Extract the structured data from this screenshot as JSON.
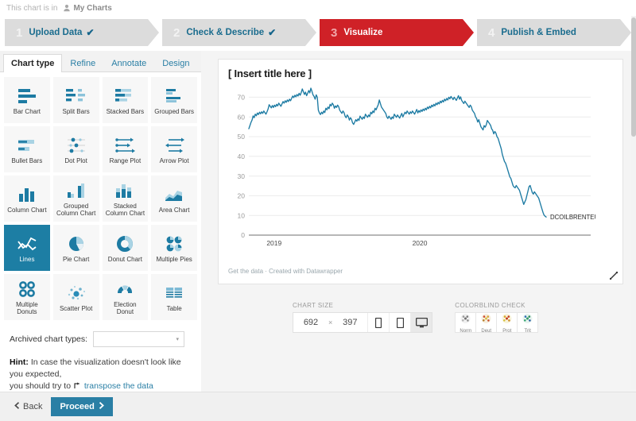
{
  "breadcrumb": {
    "prefix": "This chart is in",
    "location": "My Charts",
    "icon": "person-icon"
  },
  "steps": [
    {
      "num": "1",
      "label": "Upload Data",
      "check": "✔",
      "active": false
    },
    {
      "num": "2",
      "label": "Check & Describe",
      "check": "✔",
      "active": false
    },
    {
      "num": "3",
      "label": "Visualize",
      "check": "",
      "active": true
    },
    {
      "num": "4",
      "label": "Publish & Embed",
      "check": "",
      "active": false
    }
  ],
  "tabs": [
    {
      "label": "Chart type",
      "selected": true
    },
    {
      "label": "Refine",
      "selected": false
    },
    {
      "label": "Annotate",
      "selected": false
    },
    {
      "label": "Design",
      "selected": false
    }
  ],
  "chart_types": [
    {
      "label": "Bar Chart",
      "icon": "bar-chart-icon",
      "selected": false
    },
    {
      "label": "Split Bars",
      "icon": "split-bars-icon",
      "selected": false
    },
    {
      "label": "Stacked Bars",
      "icon": "stacked-bars-icon",
      "selected": false
    },
    {
      "label": "Grouped Bars",
      "icon": "grouped-bars-icon",
      "selected": false
    },
    {
      "label": "Bullet Bars",
      "icon": "bullet-bars-icon",
      "selected": false
    },
    {
      "label": "Dot Plot",
      "icon": "dot-plot-icon",
      "selected": false
    },
    {
      "label": "Range Plot",
      "icon": "range-plot-icon",
      "selected": false
    },
    {
      "label": "Arrow Plot",
      "icon": "arrow-plot-icon",
      "selected": false
    },
    {
      "label": "Column Chart",
      "icon": "column-chart-icon",
      "selected": false
    },
    {
      "label": "Grouped Column Chart",
      "icon": "grouped-column-chart-icon",
      "selected": false
    },
    {
      "label": "Stacked Column Chart",
      "icon": "stacked-column-chart-icon",
      "selected": false
    },
    {
      "label": "Area Chart",
      "icon": "area-chart-icon",
      "selected": false
    },
    {
      "label": "Lines",
      "icon": "lines-icon",
      "selected": true
    },
    {
      "label": "Pie Chart",
      "icon": "pie-chart-icon",
      "selected": false
    },
    {
      "label": "Donut Chart",
      "icon": "donut-chart-icon",
      "selected": false
    },
    {
      "label": "Multiple Pies",
      "icon": "multiple-pies-icon",
      "selected": false
    },
    {
      "label": "Multiple Donuts",
      "icon": "multiple-donuts-icon",
      "selected": false
    },
    {
      "label": "Scatter Plot",
      "icon": "scatter-plot-icon",
      "selected": false
    },
    {
      "label": "Election Donut",
      "icon": "election-donut-icon",
      "selected": false
    },
    {
      "label": "Table",
      "icon": "table-icon",
      "selected": false
    }
  ],
  "archived": {
    "label": "Archived chart types:",
    "value": "",
    "chevron": "▾"
  },
  "hint": {
    "bold": "Hint:",
    "text_line1": " In case the visualization doesn't look like you expected,",
    "text_line2": "you should try to",
    "link": "transpose the data",
    "link_icon": "transpose-icon"
  },
  "preview": {
    "title": "[ Insert title here ]",
    "footer": "Get the data · Created with Datawrapper",
    "resize_icon": "resize-handle-icon"
  },
  "chart_size": {
    "label": "CHART SIZE",
    "width": "692",
    "times": "×",
    "height": "397",
    "devices": [
      {
        "name": "phone-icon",
        "selected": false
      },
      {
        "name": "tablet-icon",
        "selected": false
      },
      {
        "name": "desktop-icon",
        "selected": true
      }
    ]
  },
  "colorblind": {
    "label": "COLORBLIND CHECK",
    "buttons": [
      {
        "label": "Norm",
        "icon": "colorblind-norm-icon"
      },
      {
        "label": "Deut",
        "icon": "colorblind-deut-icon"
      },
      {
        "label": "Prot",
        "icon": "colorblind-prot-icon"
      },
      {
        "label": "Trit",
        "icon": "colorblind-trit-icon"
      }
    ]
  },
  "bottom_bar": {
    "back_label": "Back",
    "back_icon": "chevron-left-icon",
    "proceed_label": "Proceed",
    "proceed_icon": "chevron-right-icon"
  },
  "colors": {
    "accent_blue": "#2a7fa5",
    "line_series": "#1d7ba3",
    "step_active": "#cf2127",
    "tile_selected": "#1d7ea4",
    "step_inactive": "#dcdcdc"
  },
  "chart_data": {
    "type": "line",
    "title": "[ Insert title here ]",
    "xlabel": "",
    "ylabel": "",
    "ylim": [
      0,
      75
    ],
    "yticks": [
      0,
      10,
      20,
      30,
      40,
      50,
      60,
      70
    ],
    "xticks": [
      "2019",
      "2020"
    ],
    "grid": true,
    "legend_position": "right-end-label",
    "series": [
      {
        "name": "DCOILBRENTEU",
        "color": "#1d7ba3",
        "values": [
          54.0,
          55.6,
          57.2,
          58.4,
          60.5,
          59.6,
          61.4,
          60.6,
          62.0,
          61.2,
          62.4,
          61.6,
          62.6,
          61.8,
          63.0,
          62.2,
          61.4,
          62.6,
          64.0,
          66.2,
          65.4,
          64.6,
          65.8,
          64.8,
          66.0,
          65.2,
          66.4,
          65.6,
          67.0,
          66.2,
          65.4,
          66.6,
          67.8,
          67.0,
          68.2,
          67.4,
          68.6,
          67.8,
          69.0,
          68.2,
          69.4,
          70.6,
          69.8,
          71.0,
          70.2,
          71.4,
          70.6,
          72.0,
          71.0,
          72.4,
          74.2,
          72.8,
          71.4,
          72.6,
          70.8,
          72.0,
          73.4,
          72.2,
          74.6,
          73.0,
          71.2,
          70.4,
          69.0,
          71.2,
          70.0,
          63.4,
          62.0,
          61.2,
          62.4,
          61.6,
          63.0,
          62.2,
          64.4,
          63.6,
          65.0,
          64.2,
          66.4,
          65.6,
          67.0,
          66.2,
          64.4,
          65.6,
          64.8,
          66.0,
          65.2,
          63.4,
          62.6,
          61.8,
          63.0,
          62.2,
          60.4,
          59.6,
          61.0,
          60.2,
          58.4,
          59.6,
          58.8,
          57.0,
          56.2,
          57.4,
          58.6,
          57.8,
          59.0,
          58.2,
          60.4,
          59.6,
          58.8,
          60.0,
          59.2,
          61.4,
          60.6,
          59.8,
          61.0,
          60.2,
          62.4,
          61.6,
          63.0,
          62.2,
          64.4,
          63.6,
          65.0,
          66.2,
          68.6,
          66.8,
          65.0,
          64.2,
          63.4,
          62.6,
          61.8,
          60.0,
          59.2,
          60.4,
          59.6,
          58.8,
          60.0,
          59.2,
          61.4,
          60.6,
          59.8,
          61.0,
          60.2,
          59.4,
          60.6,
          61.8,
          60.0,
          61.2,
          62.4,
          61.6,
          63.0,
          62.2,
          61.4,
          62.6,
          61.8,
          63.0,
          62.2,
          61.4,
          62.6,
          63.8,
          62.0,
          63.2,
          62.4,
          63.6,
          62.8,
          64.0,
          63.2,
          64.4,
          63.6,
          65.0,
          64.2,
          65.4,
          64.6,
          66.0,
          65.2,
          66.4,
          65.6,
          67.0,
          66.2,
          67.4,
          66.6,
          68.0,
          67.2,
          68.4,
          67.6,
          69.0,
          68.2,
          69.4,
          68.6,
          70.0,
          69.2,
          70.4,
          69.6,
          68.8,
          70.0,
          69.2,
          68.4,
          69.6,
          70.8,
          69.0,
          70.2,
          68.4,
          67.6,
          66.8,
          68.0,
          67.2,
          66.4,
          65.6,
          64.8,
          66.0,
          65.2,
          63.4,
          62.6,
          61.8,
          60.0,
          59.2,
          57.4,
          58.6,
          56.8,
          55.0,
          54.2,
          53.4,
          55.6,
          54.8,
          56.0,
          58.2,
          57.4,
          56.6,
          55.8,
          54.0,
          53.2,
          51.4,
          52.6,
          51.8,
          50.0,
          49.2,
          47.4,
          45.6,
          43.8,
          41.0,
          39.2,
          37.4,
          36.6,
          35.0,
          33.2,
          31.4,
          29.6,
          28.8,
          27.0,
          25.2,
          24.4,
          24.0,
          25.2,
          24.4,
          23.6,
          22.8,
          21.0,
          19.2,
          17.4,
          15.6,
          16.8,
          18.0,
          20.2,
          22.4,
          24.6,
          25.2,
          23.4,
          21.6,
          20.8,
          22.0,
          21.2,
          20.4,
          19.6,
          18.8,
          17.0,
          15.2,
          13.4,
          11.6,
          10.2,
          9.6,
          9.2
        ]
      }
    ]
  }
}
